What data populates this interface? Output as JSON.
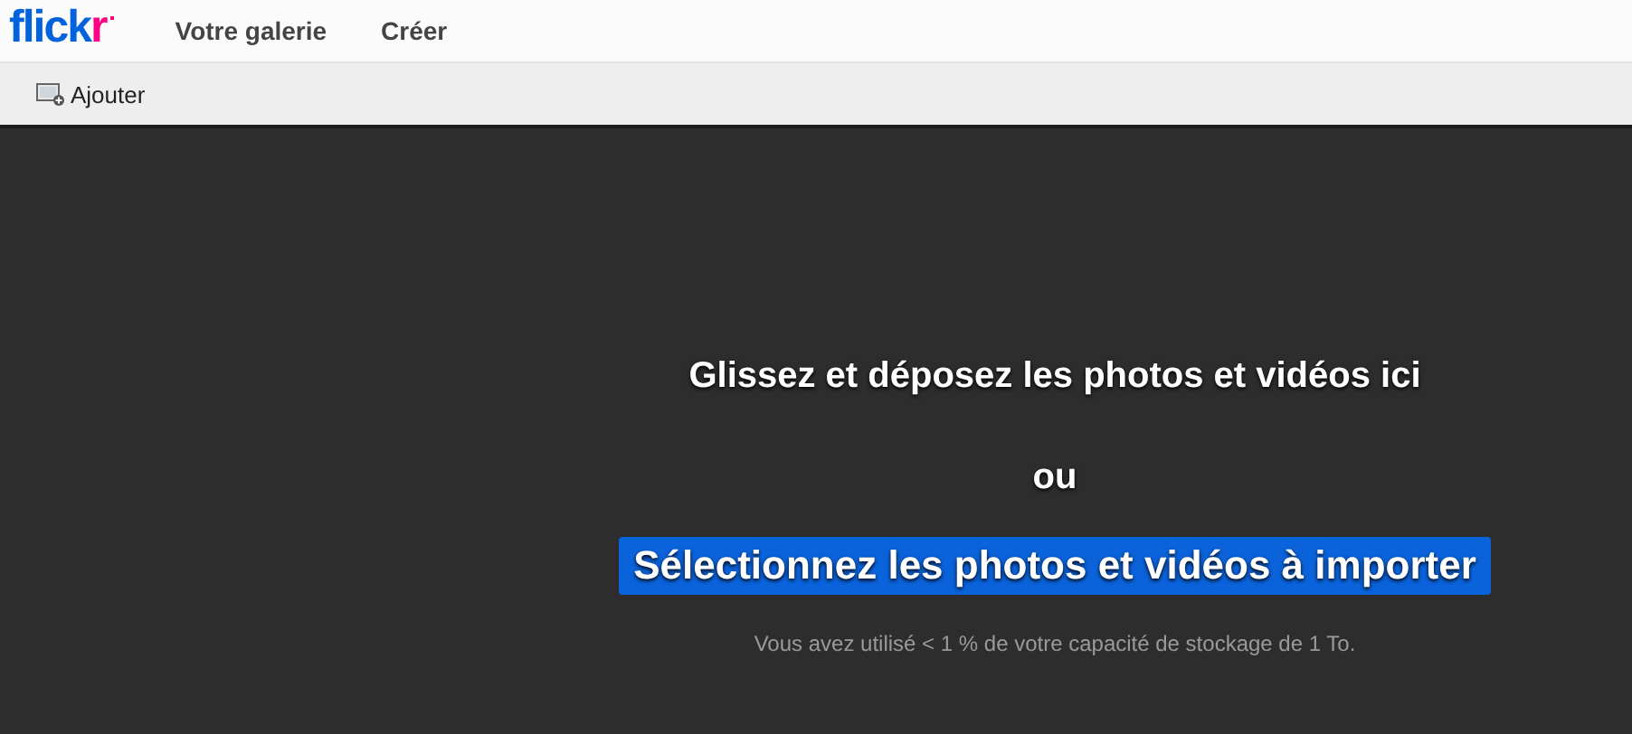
{
  "header": {
    "logo": "flickr",
    "nav": [
      {
        "label": "Votre galerie"
      },
      {
        "label": "Créer"
      }
    ]
  },
  "toolbar": {
    "add_button": "Ajouter"
  },
  "drop_zone": {
    "title": "Glissez et déposez les photos et vidéos ici",
    "separator": "ou",
    "select_button": "Sélectionnez les photos et vidéos à importer",
    "storage_note": "Vous avez utilisé < 1 % de votre capacité de stockage de 1 To."
  }
}
